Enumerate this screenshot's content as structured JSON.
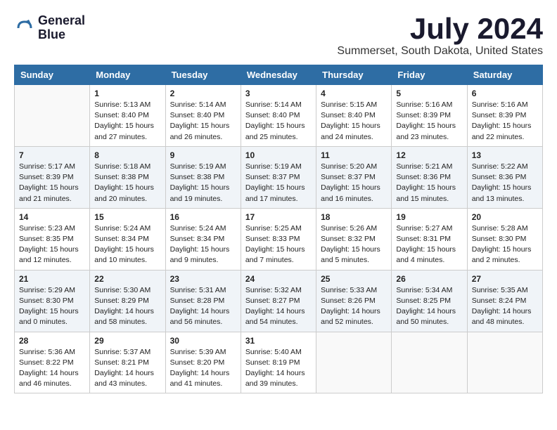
{
  "logo": {
    "line1": "General",
    "line2": "Blue"
  },
  "title": "July 2024",
  "location": "Summerset, South Dakota, United States",
  "days_of_week": [
    "Sunday",
    "Monday",
    "Tuesday",
    "Wednesday",
    "Thursday",
    "Friday",
    "Saturday"
  ],
  "weeks": [
    [
      {
        "day": "",
        "info": ""
      },
      {
        "day": "1",
        "info": "Sunrise: 5:13 AM\nSunset: 8:40 PM\nDaylight: 15 hours\nand 27 minutes."
      },
      {
        "day": "2",
        "info": "Sunrise: 5:14 AM\nSunset: 8:40 PM\nDaylight: 15 hours\nand 26 minutes."
      },
      {
        "day": "3",
        "info": "Sunrise: 5:14 AM\nSunset: 8:40 PM\nDaylight: 15 hours\nand 25 minutes."
      },
      {
        "day": "4",
        "info": "Sunrise: 5:15 AM\nSunset: 8:40 PM\nDaylight: 15 hours\nand 24 minutes."
      },
      {
        "day": "5",
        "info": "Sunrise: 5:16 AM\nSunset: 8:39 PM\nDaylight: 15 hours\nand 23 minutes."
      },
      {
        "day": "6",
        "info": "Sunrise: 5:16 AM\nSunset: 8:39 PM\nDaylight: 15 hours\nand 22 minutes."
      }
    ],
    [
      {
        "day": "7",
        "info": "Sunrise: 5:17 AM\nSunset: 8:39 PM\nDaylight: 15 hours\nand 21 minutes."
      },
      {
        "day": "8",
        "info": "Sunrise: 5:18 AM\nSunset: 8:38 PM\nDaylight: 15 hours\nand 20 minutes."
      },
      {
        "day": "9",
        "info": "Sunrise: 5:19 AM\nSunset: 8:38 PM\nDaylight: 15 hours\nand 19 minutes."
      },
      {
        "day": "10",
        "info": "Sunrise: 5:19 AM\nSunset: 8:37 PM\nDaylight: 15 hours\nand 17 minutes."
      },
      {
        "day": "11",
        "info": "Sunrise: 5:20 AM\nSunset: 8:37 PM\nDaylight: 15 hours\nand 16 minutes."
      },
      {
        "day": "12",
        "info": "Sunrise: 5:21 AM\nSunset: 8:36 PM\nDaylight: 15 hours\nand 15 minutes."
      },
      {
        "day": "13",
        "info": "Sunrise: 5:22 AM\nSunset: 8:36 PM\nDaylight: 15 hours\nand 13 minutes."
      }
    ],
    [
      {
        "day": "14",
        "info": "Sunrise: 5:23 AM\nSunset: 8:35 PM\nDaylight: 15 hours\nand 12 minutes."
      },
      {
        "day": "15",
        "info": "Sunrise: 5:24 AM\nSunset: 8:34 PM\nDaylight: 15 hours\nand 10 minutes."
      },
      {
        "day": "16",
        "info": "Sunrise: 5:24 AM\nSunset: 8:34 PM\nDaylight: 15 hours\nand 9 minutes."
      },
      {
        "day": "17",
        "info": "Sunrise: 5:25 AM\nSunset: 8:33 PM\nDaylight: 15 hours\nand 7 minutes."
      },
      {
        "day": "18",
        "info": "Sunrise: 5:26 AM\nSunset: 8:32 PM\nDaylight: 15 hours\nand 5 minutes."
      },
      {
        "day": "19",
        "info": "Sunrise: 5:27 AM\nSunset: 8:31 PM\nDaylight: 15 hours\nand 4 minutes."
      },
      {
        "day": "20",
        "info": "Sunrise: 5:28 AM\nSunset: 8:30 PM\nDaylight: 15 hours\nand 2 minutes."
      }
    ],
    [
      {
        "day": "21",
        "info": "Sunrise: 5:29 AM\nSunset: 8:30 PM\nDaylight: 15 hours\nand 0 minutes."
      },
      {
        "day": "22",
        "info": "Sunrise: 5:30 AM\nSunset: 8:29 PM\nDaylight: 14 hours\nand 58 minutes."
      },
      {
        "day": "23",
        "info": "Sunrise: 5:31 AM\nSunset: 8:28 PM\nDaylight: 14 hours\nand 56 minutes."
      },
      {
        "day": "24",
        "info": "Sunrise: 5:32 AM\nSunset: 8:27 PM\nDaylight: 14 hours\nand 54 minutes."
      },
      {
        "day": "25",
        "info": "Sunrise: 5:33 AM\nSunset: 8:26 PM\nDaylight: 14 hours\nand 52 minutes."
      },
      {
        "day": "26",
        "info": "Sunrise: 5:34 AM\nSunset: 8:25 PM\nDaylight: 14 hours\nand 50 minutes."
      },
      {
        "day": "27",
        "info": "Sunrise: 5:35 AM\nSunset: 8:24 PM\nDaylight: 14 hours\nand 48 minutes."
      }
    ],
    [
      {
        "day": "28",
        "info": "Sunrise: 5:36 AM\nSunset: 8:22 PM\nDaylight: 14 hours\nand 46 minutes."
      },
      {
        "day": "29",
        "info": "Sunrise: 5:37 AM\nSunset: 8:21 PM\nDaylight: 14 hours\nand 43 minutes."
      },
      {
        "day": "30",
        "info": "Sunrise: 5:39 AM\nSunset: 8:20 PM\nDaylight: 14 hours\nand 41 minutes."
      },
      {
        "day": "31",
        "info": "Sunrise: 5:40 AM\nSunset: 8:19 PM\nDaylight: 14 hours\nand 39 minutes."
      },
      {
        "day": "",
        "info": ""
      },
      {
        "day": "",
        "info": ""
      },
      {
        "day": "",
        "info": ""
      }
    ]
  ]
}
